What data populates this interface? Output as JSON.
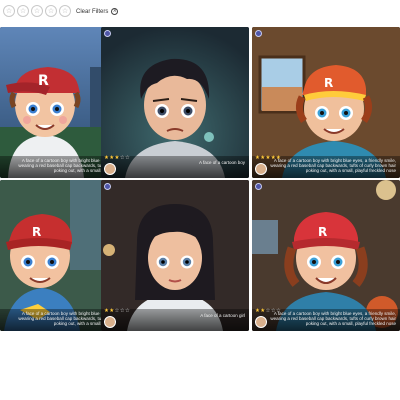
{
  "filters": {
    "star_buttons": [
      "☆",
      "☆",
      "☆",
      "☆",
      "☆"
    ],
    "clear_label": "Clear Filters",
    "clear_icon": "close-circle-icon"
  },
  "cards": [
    {
      "caption": "A face of a cartoon boy with bright blue eyes, a friendly smile, wearing a red baseball cap backwards, tufts of curly brown hair poking out, with a small, playful freckled nose",
      "rating": 0,
      "rating_shown": false
    },
    {
      "caption": "A face of a cartoon boy",
      "rating": 3,
      "rating_shown": true
    },
    {
      "caption": "A face of a cartoon boy with bright blue eyes, a friendly smile, wearing a red baseball cap backwards, tufts of curly brown hair poking out, with a small, playful freckled nose",
      "rating": 5,
      "rating_shown": true
    },
    {
      "caption": "A face of a cartoon boy with bright blue eyes, a friendly smile, wearing a red baseball cap backwards, tufts of curly brown hair poking out, with a small, playful freckled nose",
      "rating": 0,
      "rating_shown": false
    },
    {
      "caption": "A face of a cartoon girl",
      "rating": 2,
      "rating_shown": true
    },
    {
      "caption": "A face of a cartoon boy with bright blue eyes, a friendly smile, wearing a red baseball cap backwards, tufts of curly brown hair poking out, with a small, playful freckled nose",
      "rating": 2,
      "rating_shown": true
    }
  ],
  "colors": {
    "accent": "#4f56a8",
    "star_on": "#ffc93b",
    "cap_red": "#d8343a"
  }
}
